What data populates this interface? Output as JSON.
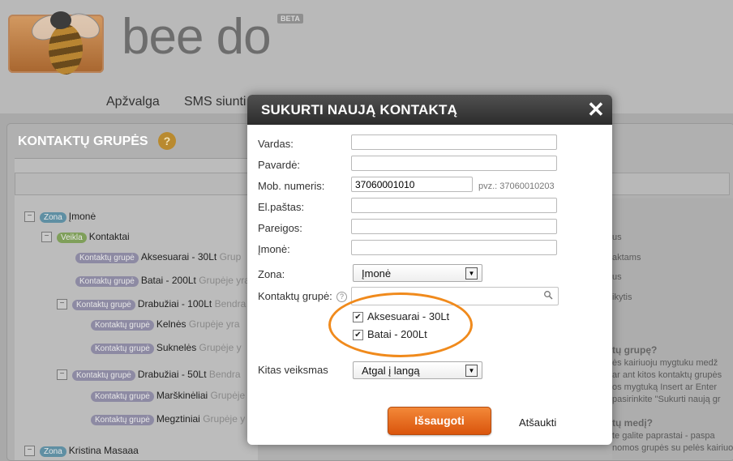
{
  "app": {
    "brand": "bee do",
    "beta_badge": "BETA"
  },
  "nav": {
    "items": [
      "Apžvalga",
      "SMS siunti"
    ]
  },
  "panel": {
    "title": "KONTAKTŲ GRUPĖS",
    "help": "?"
  },
  "tree": {
    "rows": [
      {
        "pill": "Zona",
        "label": "Įmonė",
        "suffix": ""
      },
      {
        "pill": "Veikla",
        "label": "Kontaktai",
        "suffix": ""
      },
      {
        "pill": "Kontaktų grupė",
        "label": "Aksesuarai - 30Lt",
        "suffix": "Grup"
      },
      {
        "pill": "Kontaktų grupė",
        "label": "Batai - 200Lt",
        "suffix": "Grupėje yra"
      },
      {
        "pill": "Kontaktų grupė",
        "label": "Drabužiai - 100Lt",
        "suffix": "Bendra"
      },
      {
        "pill": "Kontaktų grupė",
        "label": "Kelnės",
        "suffix": "Grupėje yra"
      },
      {
        "pill": "Kontaktų grupė",
        "label": "Suknelės",
        "suffix": "Grupėje y"
      },
      {
        "pill": "Kontaktų grupė",
        "label": "Drabužiai - 50Lt",
        "suffix": "Bendra"
      },
      {
        "pill": "Kontaktų grupė",
        "label": "Marškinėliai",
        "suffix": "Grupėje"
      },
      {
        "pill": "Kontaktų grupė",
        "label": "Megztiniai",
        "suffix": "Grupėje y"
      },
      {
        "pill": "Zona",
        "label": "Kristina Masaaa",
        "suffix": ""
      }
    ]
  },
  "side": {
    "links": [
      "us",
      "aktams",
      "us",
      "ikytis"
    ],
    "heading1": "tų grupę?",
    "text1": [
      "ės kairiuoju mygtuku medž",
      "ar ant kitos kontaktų grupės",
      "os mygtuką Insert ar Enter",
      "pasirinkite \"Sukurti naują gr"
    ],
    "heading2": "tų medį?",
    "text2": [
      "te galite paprastai - paspa",
      "nomos grupės su pelės kairiuoju mygtuku in"
    ]
  },
  "modal": {
    "title": "SUKURTI NAUJĄ KONTAKTĄ",
    "close": "✕",
    "labels": {
      "vardas": "Vardas:",
      "pavarde": "Pavardė:",
      "mob": "Mob. numeris:",
      "email": "El.paštas:",
      "pareigos": "Pareigos:",
      "imone": "Įmonė:",
      "zona": "Zona:",
      "grupe": "Kontaktų grupė:",
      "veiksmas": "Kitas veiksmas"
    },
    "values": {
      "vardas": "",
      "pavarde": "",
      "mob": "37060001010",
      "email": "",
      "pareigos": "",
      "imone": "",
      "grupe_search": ""
    },
    "mob_hint": "pvz.: 37060010203",
    "zona_selected": "Įmonė",
    "veiksmas_selected": "Atgal į langą",
    "groups": [
      {
        "label": "Aksesuarai - 30Lt",
        "checked": "✔"
      },
      {
        "label": "Batai - 200Lt",
        "checked": "✔"
      }
    ],
    "help_q": "?",
    "save_label": "Išsaugoti",
    "cancel_label": "Atšaukti"
  },
  "colors": {
    "accent": "#f08a1c",
    "header": "#2c2c2c"
  }
}
